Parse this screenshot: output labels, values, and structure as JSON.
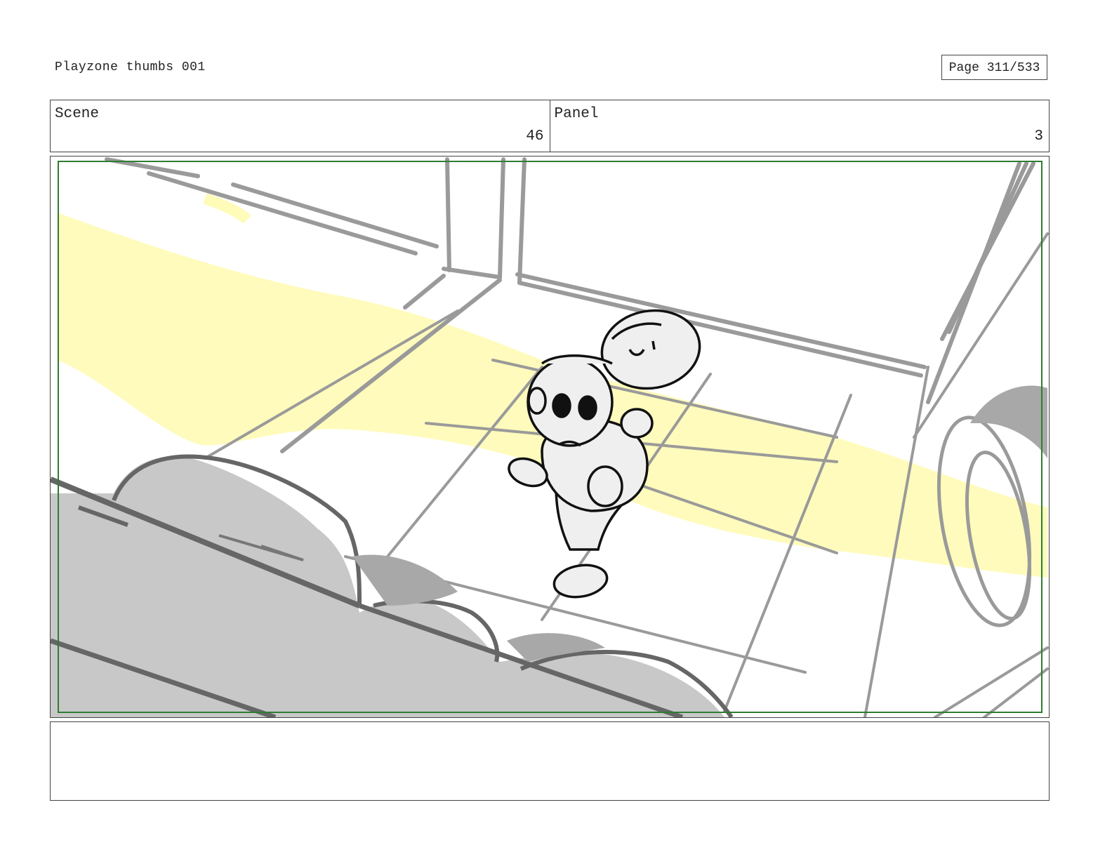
{
  "header": {
    "title": "Playzone thumbs 001",
    "page": "Page 311/533"
  },
  "info": {
    "scene_label": "Scene",
    "scene_value": "46",
    "panel_label": "Panel",
    "panel_value": "3"
  },
  "frame": {
    "description_icon": "storyboard-sketch",
    "safe_area_color": "#2e7d32",
    "highlight_color": "#fffbb8",
    "shadow_color": "#c8c8c8",
    "line_color": "#9a9a9a"
  },
  "notes": {
    "text": ""
  }
}
